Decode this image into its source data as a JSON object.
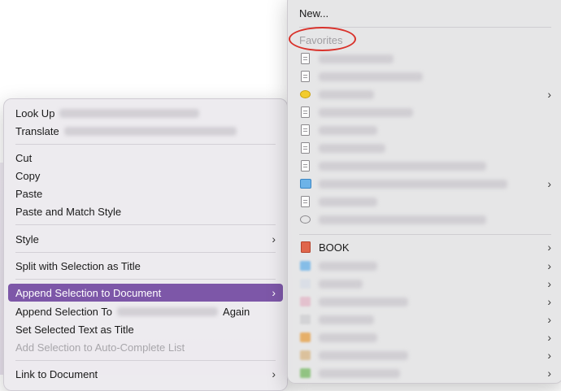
{
  "context_menu": {
    "items": [
      {
        "label": "Look Up",
        "blurred": true,
        "submenu": false,
        "state": "normal"
      },
      {
        "label": "Translate",
        "blurred": true,
        "submenu": false,
        "state": "normal"
      },
      {
        "label": "Cut",
        "submenu": false,
        "state": "normal"
      },
      {
        "label": "Copy",
        "submenu": false,
        "state": "normal"
      },
      {
        "label": "Paste",
        "submenu": false,
        "state": "normal"
      },
      {
        "label": "Paste and Match Style",
        "submenu": false,
        "state": "normal"
      },
      {
        "label": "Style",
        "submenu": true,
        "state": "normal"
      },
      {
        "label": "Split with Selection as Title",
        "submenu": false,
        "state": "normal"
      },
      {
        "label": "Append Selection to Document",
        "submenu": true,
        "state": "selected"
      },
      {
        "label": "Append Selection To",
        "suffix": "Again",
        "blurred": true,
        "submenu": false,
        "state": "normal"
      },
      {
        "label": "Set Selected Text as Title",
        "submenu": false,
        "state": "normal"
      },
      {
        "label": "Add Selection to Auto-Complete List",
        "submenu": false,
        "state": "disabled"
      },
      {
        "label": "Link to Document",
        "submenu": true,
        "state": "normal"
      }
    ],
    "selected_color": "#7d57a8"
  },
  "submenu": {
    "new_label": "New...",
    "favorites_label": "Favorites",
    "favorites_annotation_color": "#d9322b",
    "favorites": [
      {
        "icon": "document-icon",
        "submenu": false
      },
      {
        "icon": "document-icon",
        "submenu": false
      },
      {
        "icon": "yellow-bubble-icon",
        "submenu": true
      },
      {
        "icon": "document-icon",
        "submenu": false
      },
      {
        "icon": "document-icon",
        "submenu": false
      },
      {
        "icon": "document-icon",
        "submenu": false
      },
      {
        "icon": "document-icon",
        "submenu": false
      },
      {
        "icon": "group-icon",
        "submenu": true
      },
      {
        "icon": "document-icon",
        "submenu": false
      },
      {
        "icon": "outline-bubble-icon",
        "submenu": false
      }
    ],
    "groups": [
      {
        "label": "BOOK",
        "icon": "book-icon",
        "color": "#e0664b"
      },
      {
        "label": "",
        "icon": "blue-group-icon",
        "color": "#6db3e8"
      },
      {
        "label": "",
        "icon": "light-group-icon",
        "color": "#d8dde6"
      },
      {
        "label": "",
        "icon": "pink-group-icon",
        "color": "#e3b8c8"
      },
      {
        "label": "",
        "icon": "gray-group-icon",
        "color": "#cfcfd2"
      },
      {
        "label": "",
        "icon": "orange-group-icon",
        "color": "#e7a24a"
      },
      {
        "label": "",
        "icon": "tan-group-icon",
        "color": "#d9b98a"
      },
      {
        "label": "",
        "icon": "green-group-icon",
        "color": "#7dbb6a"
      }
    ]
  }
}
